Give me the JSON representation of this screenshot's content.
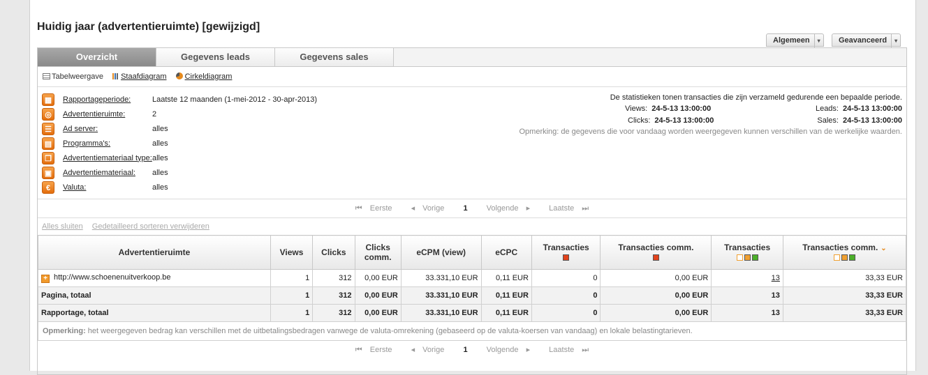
{
  "page": {
    "title": "Huidig jaar (advertentieruimte) [gewijzigd]",
    "buttons": [
      {
        "label": "Algemeen"
      },
      {
        "label": "Geavanceerd"
      }
    ]
  },
  "tabs": [
    {
      "label": "Overzicht",
      "active": true
    },
    {
      "label": "Gegevens leads"
    },
    {
      "label": "Gegevens sales"
    }
  ],
  "views": {
    "table": "Tabelweergave",
    "bar": "Staafdiagram",
    "pie": "Cirkeldiagram"
  },
  "filters": [
    {
      "icon": "calendar-icon",
      "glyph": "▦",
      "label": "Rapportageperiode:",
      "value": "Laatste 12 maanden (1-mei-2012 - 30-apr-2013)"
    },
    {
      "icon": "ad-space-icon",
      "glyph": "◎",
      "label": "Advertentieruimte:",
      "value": "2"
    },
    {
      "icon": "ad-server-icon",
      "glyph": "☰",
      "label": "Ad server:",
      "value": "alles"
    },
    {
      "icon": "programs-icon",
      "glyph": "▤",
      "label": "Programma's:",
      "value": "alles"
    },
    {
      "icon": "material-type-icon",
      "glyph": "❐",
      "label": "Advertentiemateriaal type:",
      "value": "alles"
    },
    {
      "icon": "material-icon",
      "glyph": "▣",
      "label": "Advertentiemateriaal:",
      "value": "alles"
    },
    {
      "icon": "currency-icon",
      "glyph": "€",
      "label": "Valuta:",
      "value": "alles"
    }
  ],
  "stats": {
    "intro": "De statistieken tonen transacties die zijn verzameld gedurende een bepaalde periode.",
    "views_label": "Views:",
    "views_value": "24-5-13 13:00:00",
    "clicks_label": "Clicks:",
    "clicks_value": "24-5-13 13:00:00",
    "leads_label": "Leads:",
    "leads_value": "24-5-13 13:00:00",
    "sales_label": "Sales:",
    "sales_value": "24-5-13 13:00:00",
    "remark": "Opmerking: de gegevens die voor vandaag worden weergegeven kunnen verschillen van de werkelijke waarden."
  },
  "pager": {
    "first": "Eerste",
    "prev": "Vorige",
    "current": "1",
    "next": "Volgende",
    "last": "Laatste"
  },
  "actions": {
    "close_all": "Alles sluiten",
    "remove_sort": "Gedetailleerd sorteren verwijderen"
  },
  "table": {
    "headers": [
      "Advertentieruimte",
      "Views",
      "Clicks",
      "Clicks comm.",
      "eCPM (view)",
      "eCPC",
      "Transacties",
      "Transacties comm.",
      "Transacties",
      "Transacties comm."
    ],
    "rows": [
      [
        "http://www.schoenenuitverkoop.be",
        "1",
        "312",
        "0,00 EUR",
        "33.331,10 EUR",
        "0,11 EUR",
        "0",
        "0,00 EUR",
        "13",
        "33,33 EUR"
      ],
      [
        "Pagina, totaal",
        "1",
        "312",
        "0,00 EUR",
        "33.331,10 EUR",
        "0,11 EUR",
        "0",
        "0,00 EUR",
        "13",
        "33,33 EUR"
      ],
      [
        "Rapportage, totaal",
        "1",
        "312",
        "0,00 EUR",
        "33.331,10 EUR",
        "0,11 EUR",
        "0",
        "0,00 EUR",
        "13",
        "33,33 EUR"
      ]
    ]
  },
  "note": {
    "label": "Opmerking:",
    "text": "het weergegeven bedrag kan verschillen met de uitbetalingsbedragen vanwege de valuta-omrekening (gebaseerd op de valuta-koersen van vandaag) en lokale belastingtarieven."
  },
  "colors": {
    "status_red": "#e2431d",
    "status_orange": "#f0a030",
    "status_green": "#4caf2a",
    "icon_orange": "#e36d0c"
  }
}
